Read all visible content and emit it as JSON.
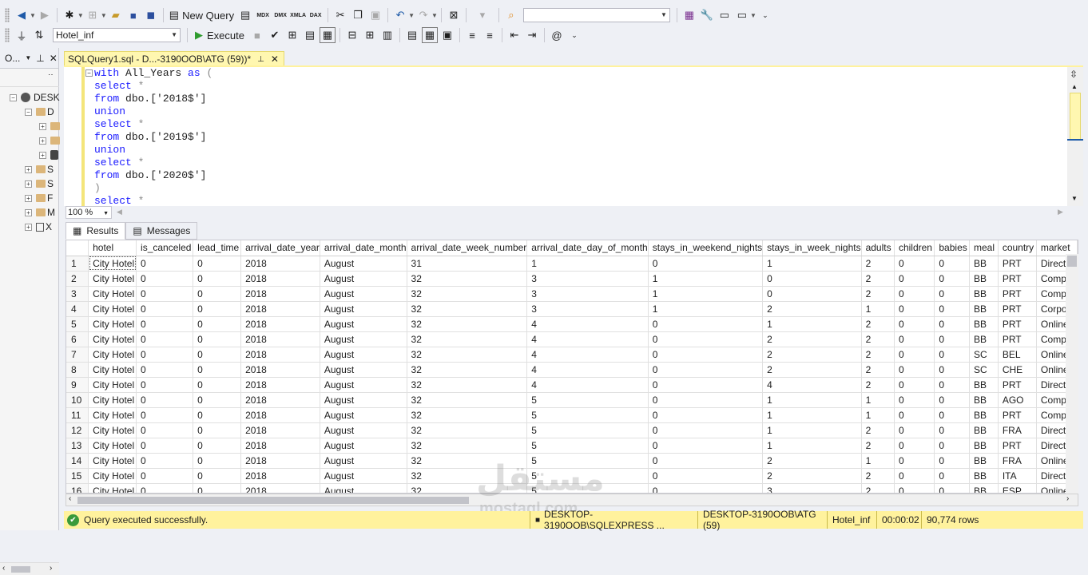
{
  "toolbar1": {
    "new_query_label": "New Query",
    "icons": [
      "back-icon",
      "forward-icon",
      "new-project-icon",
      "open-icon",
      "save-icon",
      "save-all-icon",
      "new-query-icon",
      "mdx-icon",
      "dmx-icon",
      "xmla-icon",
      "dax-icon",
      "cut-icon",
      "copy-icon",
      "paste-icon",
      "undo-icon",
      "redo-icon",
      "activity-monitor-icon",
      "find-icon",
      "properties-icon",
      "tools-icon",
      "toolbox-icon",
      "terminal-icon"
    ],
    "mdx_label": "MDX",
    "dmx_label": "DMX",
    "xmla_label": "XMLA",
    "dax_label": "DAX",
    "search_value": ""
  },
  "toolbar2": {
    "database": "Hotel_inf",
    "execute_label": "Execute"
  },
  "object_explorer": {
    "title": "O...",
    "server_label": "DESK",
    "items": [
      "D",
      "",
      "",
      "S",
      "S",
      "F",
      "M",
      "X"
    ]
  },
  "document_tab": {
    "title": "SQLQuery1.sql - D...-3190OOB\\ATG (59))*"
  },
  "editor": {
    "lines": [
      [
        {
          "t": "with",
          "c": "kw"
        },
        {
          "t": " All_Years ",
          "c": ""
        },
        {
          "t": "as",
          "c": "kw"
        },
        {
          "t": " (",
          "c": "gy"
        }
      ],
      [
        {
          "t": "select",
          "c": "kw"
        },
        {
          "t": " *",
          "c": "gy"
        }
      ],
      [
        {
          "t": "from",
          "c": "kw"
        },
        {
          "t": " dbo.['2018$']",
          "c": ""
        }
      ],
      [
        {
          "t": "union",
          "c": "kw"
        }
      ],
      [
        {
          "t": "select",
          "c": "kw"
        },
        {
          "t": " *",
          "c": "gy"
        }
      ],
      [
        {
          "t": "from",
          "c": "kw"
        },
        {
          "t": " dbo.['2019$']",
          "c": ""
        }
      ],
      [
        {
          "t": "union",
          "c": "kw"
        }
      ],
      [
        {
          "t": "select",
          "c": "kw"
        },
        {
          "t": " *",
          "c": "gy"
        }
      ],
      [
        {
          "t": "from",
          "c": "kw"
        },
        {
          "t": " dbo.['2020$']",
          "c": ""
        }
      ],
      [
        {
          "t": ")",
          "c": "gy"
        }
      ],
      [
        {
          "t": "select",
          "c": "kw"
        },
        {
          "t": " *",
          "c": "gy"
        }
      ]
    ],
    "zoom": "100 %"
  },
  "results": {
    "tabs": [
      "Results",
      "Messages"
    ],
    "columns": [
      "hotel",
      "is_canceled",
      "lead_time",
      "arrival_date_year",
      "arrival_date_month",
      "arrival_date_week_number",
      "arrival_date_day_of_month",
      "stays_in_weekend_nights",
      "stays_in_week_nights",
      "adults",
      "children",
      "babies",
      "meal",
      "country",
      "market"
    ],
    "rows": [
      [
        "1",
        "City Hotel",
        "0",
        "0",
        "2018",
        "August",
        "31",
        "1",
        "0",
        "1",
        "2",
        "0",
        "0",
        "BB",
        "PRT",
        "Direct"
      ],
      [
        "2",
        "City Hotel",
        "0",
        "0",
        "2018",
        "August",
        "32",
        "3",
        "1",
        "0",
        "2",
        "0",
        "0",
        "BB",
        "PRT",
        "Compl"
      ],
      [
        "3",
        "City Hotel",
        "0",
        "0",
        "2018",
        "August",
        "32",
        "3",
        "1",
        "0",
        "2",
        "0",
        "0",
        "BB",
        "PRT",
        "Compl"
      ],
      [
        "4",
        "City Hotel",
        "0",
        "0",
        "2018",
        "August",
        "32",
        "3",
        "1",
        "2",
        "1",
        "0",
        "0",
        "BB",
        "PRT",
        "Corpor"
      ],
      [
        "5",
        "City Hotel",
        "0",
        "0",
        "2018",
        "August",
        "32",
        "4",
        "0",
        "1",
        "2",
        "0",
        "0",
        "BB",
        "PRT",
        "Online"
      ],
      [
        "6",
        "City Hotel",
        "0",
        "0",
        "2018",
        "August",
        "32",
        "4",
        "0",
        "2",
        "2",
        "0",
        "0",
        "BB",
        "PRT",
        "Compl"
      ],
      [
        "7",
        "City Hotel",
        "0",
        "0",
        "2018",
        "August",
        "32",
        "4",
        "0",
        "2",
        "2",
        "0",
        "0",
        "SC",
        "BEL",
        "Online"
      ],
      [
        "8",
        "City Hotel",
        "0",
        "0",
        "2018",
        "August",
        "32",
        "4",
        "0",
        "2",
        "2",
        "0",
        "0",
        "SC",
        "CHE",
        "Online"
      ],
      [
        "9",
        "City Hotel",
        "0",
        "0",
        "2018",
        "August",
        "32",
        "4",
        "0",
        "4",
        "2",
        "0",
        "0",
        "BB",
        "PRT",
        "Direct"
      ],
      [
        "10",
        "City Hotel",
        "0",
        "0",
        "2018",
        "August",
        "32",
        "5",
        "0",
        "1",
        "1",
        "0",
        "0",
        "BB",
        "AGO",
        "Compl"
      ],
      [
        "11",
        "City Hotel",
        "0",
        "0",
        "2018",
        "August",
        "32",
        "5",
        "0",
        "1",
        "1",
        "0",
        "0",
        "BB",
        "PRT",
        "Compl"
      ],
      [
        "12",
        "City Hotel",
        "0",
        "0",
        "2018",
        "August",
        "32",
        "5",
        "0",
        "1",
        "2",
        "0",
        "0",
        "BB",
        "FRA",
        "Direct"
      ],
      [
        "13",
        "City Hotel",
        "0",
        "0",
        "2018",
        "August",
        "32",
        "5",
        "0",
        "1",
        "2",
        "0",
        "0",
        "BB",
        "PRT",
        "Direct"
      ],
      [
        "14",
        "City Hotel",
        "0",
        "0",
        "2018",
        "August",
        "32",
        "5",
        "0",
        "2",
        "1",
        "0",
        "0",
        "BB",
        "FRA",
        "Online"
      ],
      [
        "15",
        "City Hotel",
        "0",
        "0",
        "2018",
        "August",
        "32",
        "5",
        "0",
        "2",
        "2",
        "0",
        "0",
        "BB",
        "ITA",
        "Direct"
      ],
      [
        "16",
        "City Hotel",
        "0",
        "0",
        "2018",
        "August",
        "32",
        "5",
        "0",
        "3",
        "2",
        "0",
        "0",
        "BB",
        "ESP",
        "Online"
      ]
    ]
  },
  "status": {
    "message": "Query executed successfully.",
    "server": "DESKTOP-3190OOB\\SQLEXPRESS ...",
    "login": "DESKTOP-3190OOB\\ATG (59)",
    "database": "Hotel_inf",
    "elapsed": "00:00:02",
    "rows": "90,774 rows"
  },
  "watermark": {
    "arabic": "مستقل",
    "latin": "mostaql.com"
  }
}
